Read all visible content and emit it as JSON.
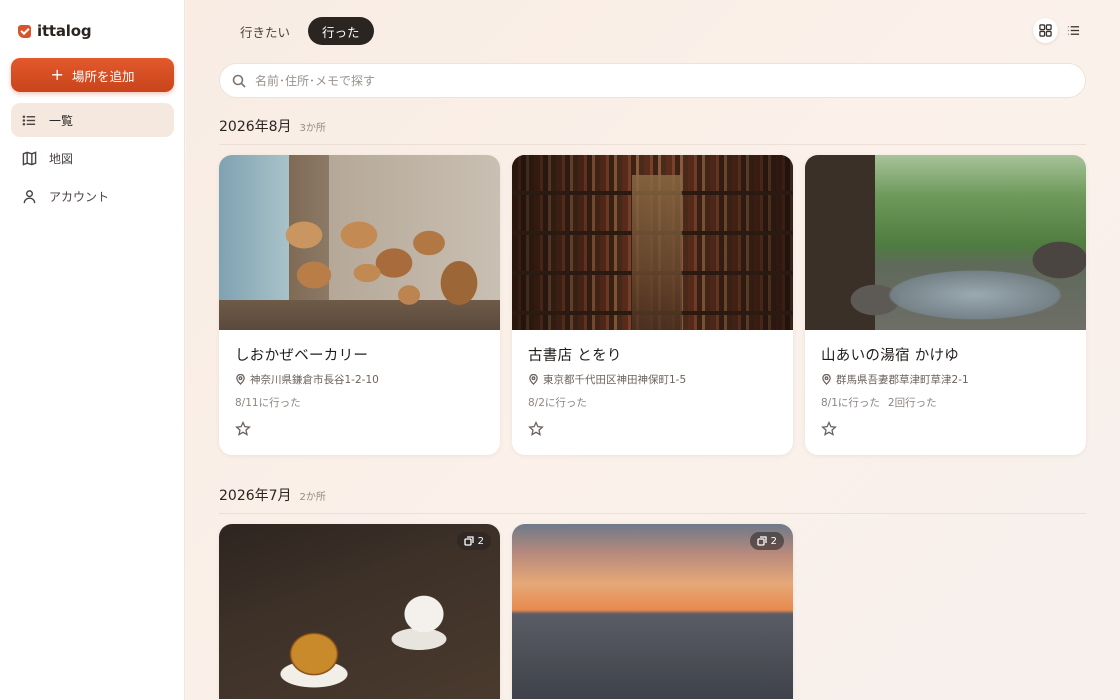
{
  "app": {
    "name": "ittalog"
  },
  "sidebar": {
    "add_button_label": "場所を追加",
    "items": [
      {
        "label": "一覧",
        "icon": "list-icon",
        "active": true
      },
      {
        "label": "地図",
        "icon": "map-icon",
        "active": false
      },
      {
        "label": "アカウント",
        "icon": "user-icon",
        "active": false
      }
    ]
  },
  "tabs": [
    {
      "label": "行きたい",
      "active": false
    },
    {
      "label": "行った",
      "active": true
    }
  ],
  "view_toggle": {
    "selected": "grid"
  },
  "search": {
    "placeholder": "名前･住所･メモで探す",
    "value": ""
  },
  "sections": [
    {
      "title": "2026年8月",
      "count": "3か所",
      "cards": [
        {
          "title": "しおかぜベーカリー",
          "address": "神奈川県鎌倉市長谷1-2-10",
          "visit": "8/11に行った",
          "visit_extra": "",
          "photos": "",
          "image": "bakery"
        },
        {
          "title": "古書店 とをり",
          "address": "東京都千代田区神田神保町1-5",
          "visit": "8/2に行った",
          "visit_extra": "",
          "photos": "",
          "image": "books"
        },
        {
          "title": "山あいの湯宿 かけゆ",
          "address": "群馬県吾妻郡草津町草津2-1",
          "visit": "8/1に行った",
          "visit_extra": "2回行った",
          "photos": "",
          "image": "onsen"
        }
      ]
    },
    {
      "title": "2026年7月",
      "count": "2か所",
      "cards": [
        {
          "title": "",
          "address": "",
          "visit": "",
          "photos": "2",
          "image": "pudding"
        },
        {
          "title": "",
          "address": "",
          "visit": "",
          "photos": "2",
          "image": "sunset"
        }
      ]
    }
  ],
  "colors": {
    "accent": "#d9542a",
    "active_tab": "#2b2522",
    "background": "#fbf1e9"
  }
}
